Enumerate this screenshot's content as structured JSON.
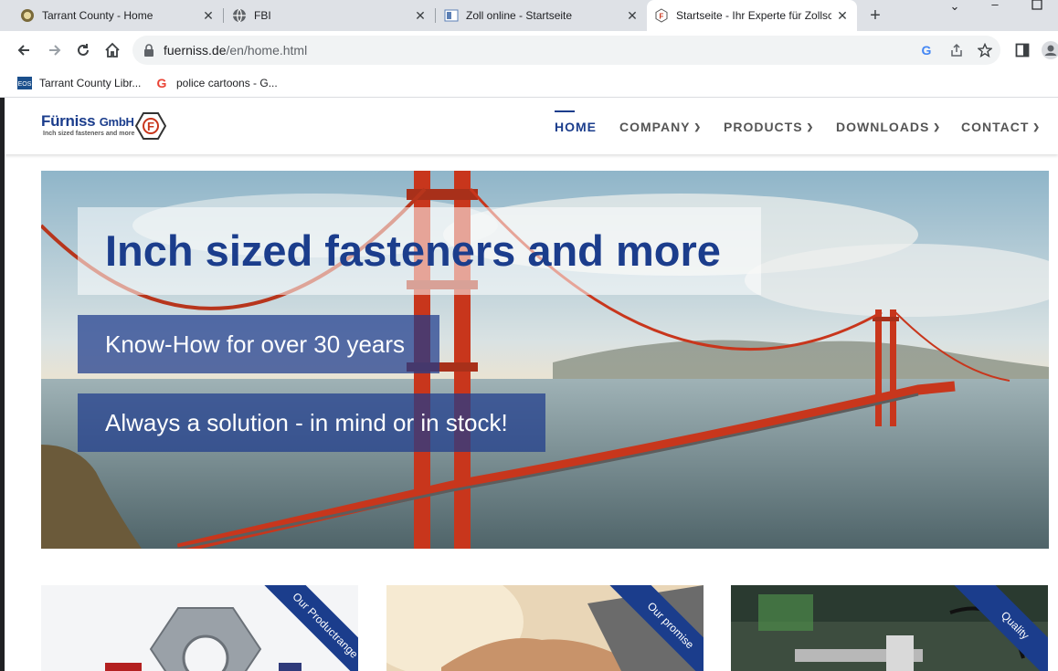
{
  "browser": {
    "tabs": [
      {
        "title": "Tarrant County - Home",
        "icon": "county-seal-icon"
      },
      {
        "title": "FBI",
        "icon": "globe-icon"
      },
      {
        "title": "Zoll online - Startseite",
        "icon": "zoll-icon"
      },
      {
        "title": "Startseite - Ihr Experte für Zollschrauben",
        "icon": "fuerniss-icon"
      }
    ],
    "url_domain": "fuerniss.de",
    "url_path": "/en/home.html",
    "bookmarks": [
      {
        "label": "Tarrant County Libr...",
        "icon": "eos-icon"
      },
      {
        "label": "police cartoons - G...",
        "icon": "google-icon"
      }
    ]
  },
  "site": {
    "logo_brand": "Fürniss",
    "logo_suffix": "GmbH",
    "logo_tagline": "Inch sized fasteners and more",
    "nav": [
      {
        "label": "HOME",
        "active": true
      },
      {
        "label": "COMPANY",
        "dropdown": true
      },
      {
        "label": "PRODUCTS",
        "dropdown": true
      },
      {
        "label": "DOWNLOADS",
        "dropdown": true
      },
      {
        "label": "CONTACT",
        "dropdown": true
      }
    ],
    "hero": {
      "headline": "Inch sized fasteners and more",
      "line1": "Know-How for over 30 years",
      "line2": "Always a solution - in mind or in stock!"
    },
    "cards": [
      {
        "ribbon": "Our Productrange"
      },
      {
        "ribbon": "Our promise"
      },
      {
        "ribbon": "Quality"
      }
    ]
  },
  "colors": {
    "brand_blue": "#1b3d8c",
    "bridge_red": "#c8361c"
  }
}
